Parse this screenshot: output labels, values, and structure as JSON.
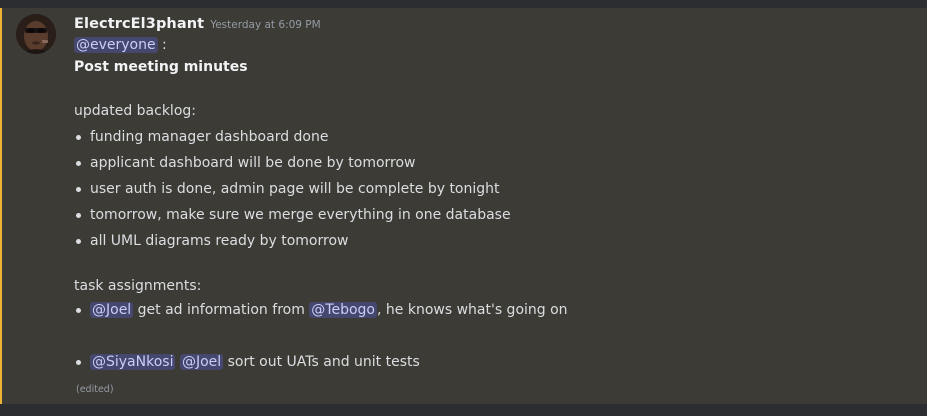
{
  "message": {
    "author": "ElectrcEl3phant",
    "timestamp": "Yesterday at 6:09 PM",
    "mention_everyone": "@everyone",
    "mention_suffix": " :",
    "title": "Post meeting minutes",
    "backlog_heading": "updated backlog:",
    "backlog_items": [
      "funding manager dashboard done",
      "applicant dashboard will be done by tomorrow",
      "user auth is done, admin page will be complete by tonight",
      "tomorrow, make sure we merge everything in one database",
      "all UML diagrams ready by tomorrow"
    ],
    "tasks_heading": "task assignments:",
    "task1": {
      "mention_a": "@Joel",
      "text_a": " get ad information from ",
      "mention_b": "@Tebogo",
      "text_b": ", he knows what's going on"
    },
    "task2": {
      "mention_a": "@SiyaNkosi",
      "mention_b": "@Joel",
      "text": " sort out UATs and unit tests"
    },
    "edited_label": "(edited)"
  },
  "colors": {
    "background": "#2b2d31",
    "message_highlight": "#3d3b36",
    "highlight_bar": "#f0b232",
    "mention_bg": "#4b4f7a",
    "mention_text": "#c9cdfb",
    "text": "#dbdee1",
    "muted": "#949ba4"
  }
}
